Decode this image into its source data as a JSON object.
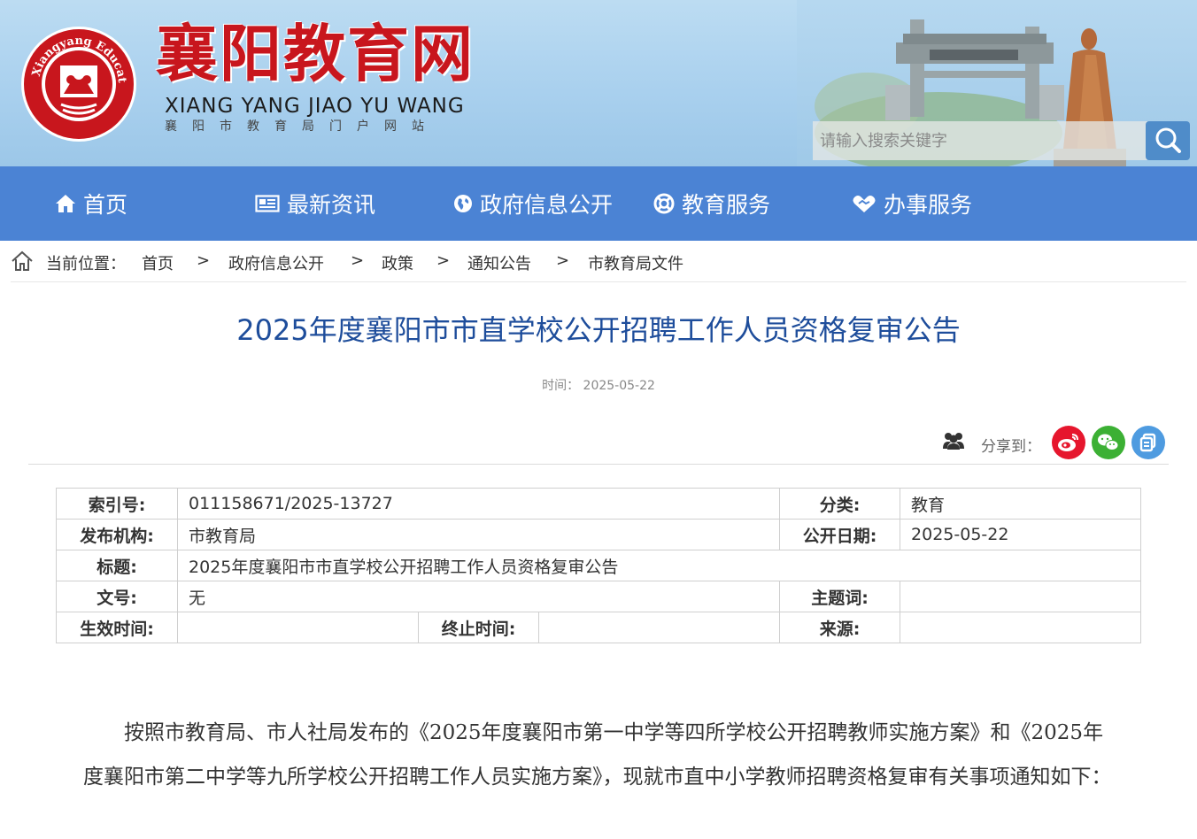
{
  "header": {
    "site_title": "襄阳教育网",
    "site_pinyin": "XIANG YANG JIAO YU WANG",
    "site_subtitle": "襄阳市教育局门户网站",
    "seal_text": "Xiangyang Education",
    "search": {
      "placeholder": "请输入搜索关键字"
    }
  },
  "nav": {
    "items": [
      {
        "label": "首页",
        "icon": "home-icon"
      },
      {
        "label": "最新资讯",
        "icon": "news-icon"
      },
      {
        "label": "政府信息公开",
        "icon": "globe-icon"
      },
      {
        "label": "教育服务",
        "icon": "lifebuoy-icon"
      },
      {
        "label": "办事服务",
        "icon": "handshake-icon"
      }
    ]
  },
  "breadcrumb": {
    "prefix": "当前位置：",
    "separator": ">",
    "items": [
      "首页",
      "政府信息公开",
      "政策",
      "通知公告",
      "市教育局文件"
    ]
  },
  "article": {
    "title": "2025年度襄阳市市直学校公开招聘工作人员资格复审公告",
    "time_label": "时间：",
    "time": "2025-05-22",
    "share_label": "分享到：",
    "share_targets": [
      "weibo",
      "wechat",
      "copy"
    ]
  },
  "info": {
    "index_label": "索引号:",
    "index_value": "011158671/2025-13727",
    "category_label": "分类:",
    "category_value": "教育",
    "publisher_label": "发布机构:",
    "publisher_value": "市教育局",
    "pubdate_label": "公开日期:",
    "pubdate_value": "2025-05-22",
    "title_label": "标题:",
    "title_value": "2025年度襄阳市市直学校公开招聘工作人员资格复审公告",
    "docno_label": "文号:",
    "docno_value": "无",
    "keywords_label": "主题词:",
    "keywords_value": "",
    "effective_label": "生效时间:",
    "effective_value": "",
    "expiry_label": "终止时间:",
    "expiry_value": "",
    "source_label": "来源:",
    "source_value": ""
  },
  "body": {
    "paragraph": "按照市教育局、市人社局发布的《2025年度襄阳市第一中学等四所学校公开招聘教师实施方案》和《2025年度襄阳市第二中学等九所学校公开招聘工作人员实施方案》，现就市直中小学教师招聘资格复审有关事项通知如下："
  },
  "colors": {
    "nav_bg": "#4b83d4",
    "title_blue": "#1e4d9b",
    "brand_red": "#c8161d",
    "weibo": "#e6162d",
    "wechat": "#3cb034",
    "copy": "#4e9be0"
  }
}
